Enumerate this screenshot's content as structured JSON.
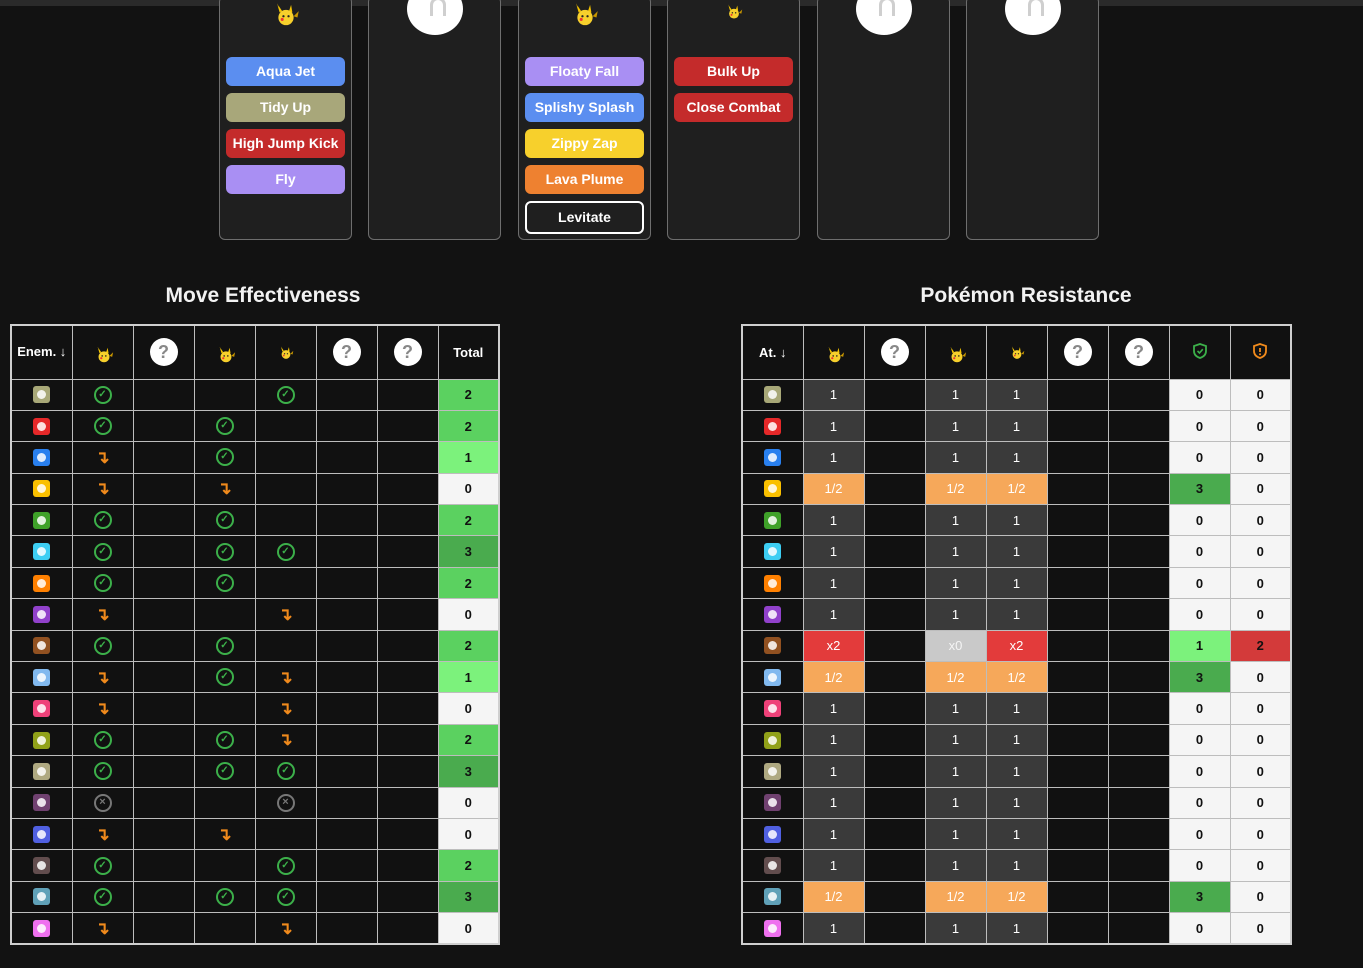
{
  "team_cards": [
    {
      "filled": true,
      "moves": [
        {
          "label": "Aqua Jet",
          "color": "#5b8ef0",
          "text": "#fff"
        },
        {
          "label": "Tidy Up",
          "color": "#a8a77a",
          "text": "#fff"
        },
        {
          "label": "High Jump Kick",
          "color": "#c42b2b",
          "text": "#fff"
        },
        {
          "label": "Fly",
          "color": "#a98ff3",
          "text": "#fff"
        }
      ]
    },
    {
      "filled": false,
      "moves": []
    },
    {
      "filled": true,
      "moves": [
        {
          "label": "Floaty Fall",
          "color": "#a98ff3",
          "text": "#fff"
        },
        {
          "label": "Splishy Splash",
          "color": "#5b8ef0",
          "text": "#fff"
        },
        {
          "label": "Zippy Zap",
          "color": "#f7d02c",
          "text": "#fff"
        },
        {
          "label": "Lava Plume",
          "color": "#ee8130",
          "text": "#fff"
        },
        {
          "label": "Levitate",
          "color": "transparent",
          "text": "#fff",
          "outlined": true
        }
      ]
    },
    {
      "filled": true,
      "moves": [
        {
          "label": "Bulk Up",
          "color": "#c42b2b",
          "text": "#fff"
        },
        {
          "label": "Close Combat",
          "color": "#c42b2b",
          "text": "#fff"
        }
      ]
    },
    {
      "filled": false,
      "moves": []
    },
    {
      "filled": false,
      "moves": []
    }
  ],
  "effectiveness": {
    "title": "Move Effectiveness",
    "corner_label": "Enem. ↓",
    "total_label": "Total",
    "columns": [
      "pikachu",
      "unknown",
      "pikachu",
      "pikachu-small",
      "unknown",
      "unknown"
    ],
    "rows": [
      {
        "type": "normal",
        "color": "#a8a878",
        "cells": [
          "check",
          "",
          "",
          "check",
          "",
          ""
        ],
        "total": "2"
      },
      {
        "type": "fire",
        "color": "#e62829",
        "cells": [
          "check",
          "",
          "check",
          "",
          "",
          ""
        ],
        "total": "2"
      },
      {
        "type": "water",
        "color": "#2980ef",
        "cells": [
          "arrow",
          "",
          "check",
          "",
          "",
          ""
        ],
        "total": "1"
      },
      {
        "type": "electric",
        "color": "#fac000",
        "cells": [
          "arrow",
          "",
          "arrow",
          "",
          "",
          ""
        ],
        "total": "0"
      },
      {
        "type": "grass",
        "color": "#3fa129",
        "cells": [
          "check",
          "",
          "check",
          "",
          "",
          ""
        ],
        "total": "2"
      },
      {
        "type": "ice",
        "color": "#3dcef3",
        "cells": [
          "check",
          "",
          "check",
          "check",
          "",
          ""
        ],
        "total": "3"
      },
      {
        "type": "fighting",
        "color": "#ff8000",
        "cells": [
          "check",
          "",
          "check",
          "",
          "",
          ""
        ],
        "total": "2"
      },
      {
        "type": "poison",
        "color": "#9141cb",
        "cells": [
          "arrow",
          "",
          "",
          "arrow",
          "",
          ""
        ],
        "total": "0"
      },
      {
        "type": "ground",
        "color": "#915121",
        "cells": [
          "check",
          "",
          "check",
          "",
          "",
          ""
        ],
        "total": "2"
      },
      {
        "type": "flying",
        "color": "#81b9ef",
        "cells": [
          "arrow",
          "",
          "check",
          "arrow",
          "",
          ""
        ],
        "total": "1"
      },
      {
        "type": "psychic",
        "color": "#ef4179",
        "cells": [
          "arrow",
          "",
          "",
          "arrow",
          "",
          ""
        ],
        "total": "0"
      },
      {
        "type": "bug",
        "color": "#91a119",
        "cells": [
          "check",
          "",
          "check",
          "arrow",
          "",
          ""
        ],
        "total": "2"
      },
      {
        "type": "rock",
        "color": "#afa981",
        "cells": [
          "check",
          "",
          "check",
          "check",
          "",
          ""
        ],
        "total": "3"
      },
      {
        "type": "ghost",
        "color": "#704170",
        "cells": [
          "cross",
          "",
          "",
          "cross",
          "",
          ""
        ],
        "total": "0"
      },
      {
        "type": "dragon",
        "color": "#5060e1",
        "cells": [
          "arrow",
          "",
          "arrow",
          "",
          "",
          ""
        ],
        "total": "0"
      },
      {
        "type": "dark",
        "color": "#624d4e",
        "cells": [
          "check",
          "",
          "",
          "check",
          "",
          ""
        ],
        "total": "2"
      },
      {
        "type": "steel",
        "color": "#60a1b8",
        "cells": [
          "check",
          "",
          "check",
          "check",
          "",
          ""
        ],
        "total": "3"
      },
      {
        "type": "fairy",
        "color": "#ef70ef",
        "cells": [
          "arrow",
          "",
          "",
          "arrow",
          "",
          ""
        ],
        "total": "0"
      }
    ]
  },
  "resistance": {
    "title": "Pokémon Resistance",
    "corner_label": "At. ↓",
    "columns": [
      "pikachu",
      "unknown",
      "pikachu",
      "pikachu-small",
      "unknown",
      "unknown",
      "resist-shield",
      "weak-shield"
    ],
    "rows": [
      {
        "cells": [
          "1",
          "",
          "1",
          "1",
          "",
          ""
        ],
        "resist": "0",
        "weak": "0"
      },
      {
        "cells": [
          "1",
          "",
          "1",
          "1",
          "",
          ""
        ],
        "resist": "0",
        "weak": "0"
      },
      {
        "cells": [
          "1",
          "",
          "1",
          "1",
          "",
          ""
        ],
        "resist": "0",
        "weak": "0"
      },
      {
        "cells": [
          "1/2",
          "",
          "1/2",
          "1/2",
          "",
          ""
        ],
        "resist": "3",
        "weak": "0"
      },
      {
        "cells": [
          "1",
          "",
          "1",
          "1",
          "",
          ""
        ],
        "resist": "0",
        "weak": "0"
      },
      {
        "cells": [
          "1",
          "",
          "1",
          "1",
          "",
          ""
        ],
        "resist": "0",
        "weak": "0"
      },
      {
        "cells": [
          "1",
          "",
          "1",
          "1",
          "",
          ""
        ],
        "resist": "0",
        "weak": "0"
      },
      {
        "cells": [
          "1",
          "",
          "1",
          "1",
          "",
          ""
        ],
        "resist": "0",
        "weak": "0"
      },
      {
        "cells": [
          "x2",
          "",
          "x0",
          "x2",
          "",
          ""
        ],
        "resist": "1",
        "weak": "2"
      },
      {
        "cells": [
          "1/2",
          "",
          "1/2",
          "1/2",
          "",
          ""
        ],
        "resist": "3",
        "weak": "0"
      },
      {
        "cells": [
          "1",
          "",
          "1",
          "1",
          "",
          ""
        ],
        "resist": "0",
        "weak": "0"
      },
      {
        "cells": [
          "1",
          "",
          "1",
          "1",
          "",
          ""
        ],
        "resist": "0",
        "weak": "0"
      },
      {
        "cells": [
          "1",
          "",
          "1",
          "1",
          "",
          ""
        ],
        "resist": "0",
        "weak": "0"
      },
      {
        "cells": [
          "1",
          "",
          "1",
          "1",
          "",
          ""
        ],
        "resist": "0",
        "weak": "0"
      },
      {
        "cells": [
          "1",
          "",
          "1",
          "1",
          "",
          ""
        ],
        "resist": "0",
        "weak": "0"
      },
      {
        "cells": [
          "1",
          "",
          "1",
          "1",
          "",
          ""
        ],
        "resist": "0",
        "weak": "0"
      },
      {
        "cells": [
          "1/2",
          "",
          "1/2",
          "1/2",
          "",
          ""
        ],
        "resist": "3",
        "weak": "0"
      },
      {
        "cells": [
          "1",
          "",
          "1",
          "1",
          "",
          ""
        ],
        "resist": "0",
        "weak": "0"
      }
    ]
  },
  "colors": {
    "total_0": "#f5f5f5",
    "total_1": "#7cf27c",
    "total_2": "#5bd160",
    "total_3": "#4aab4e",
    "mult_1": "#3a3a3a",
    "mult_half": "#f6a85a",
    "mult_x2": "#e33b3b",
    "mult_x0": "#c9c9c9",
    "weak_2": "#d33a3a"
  }
}
